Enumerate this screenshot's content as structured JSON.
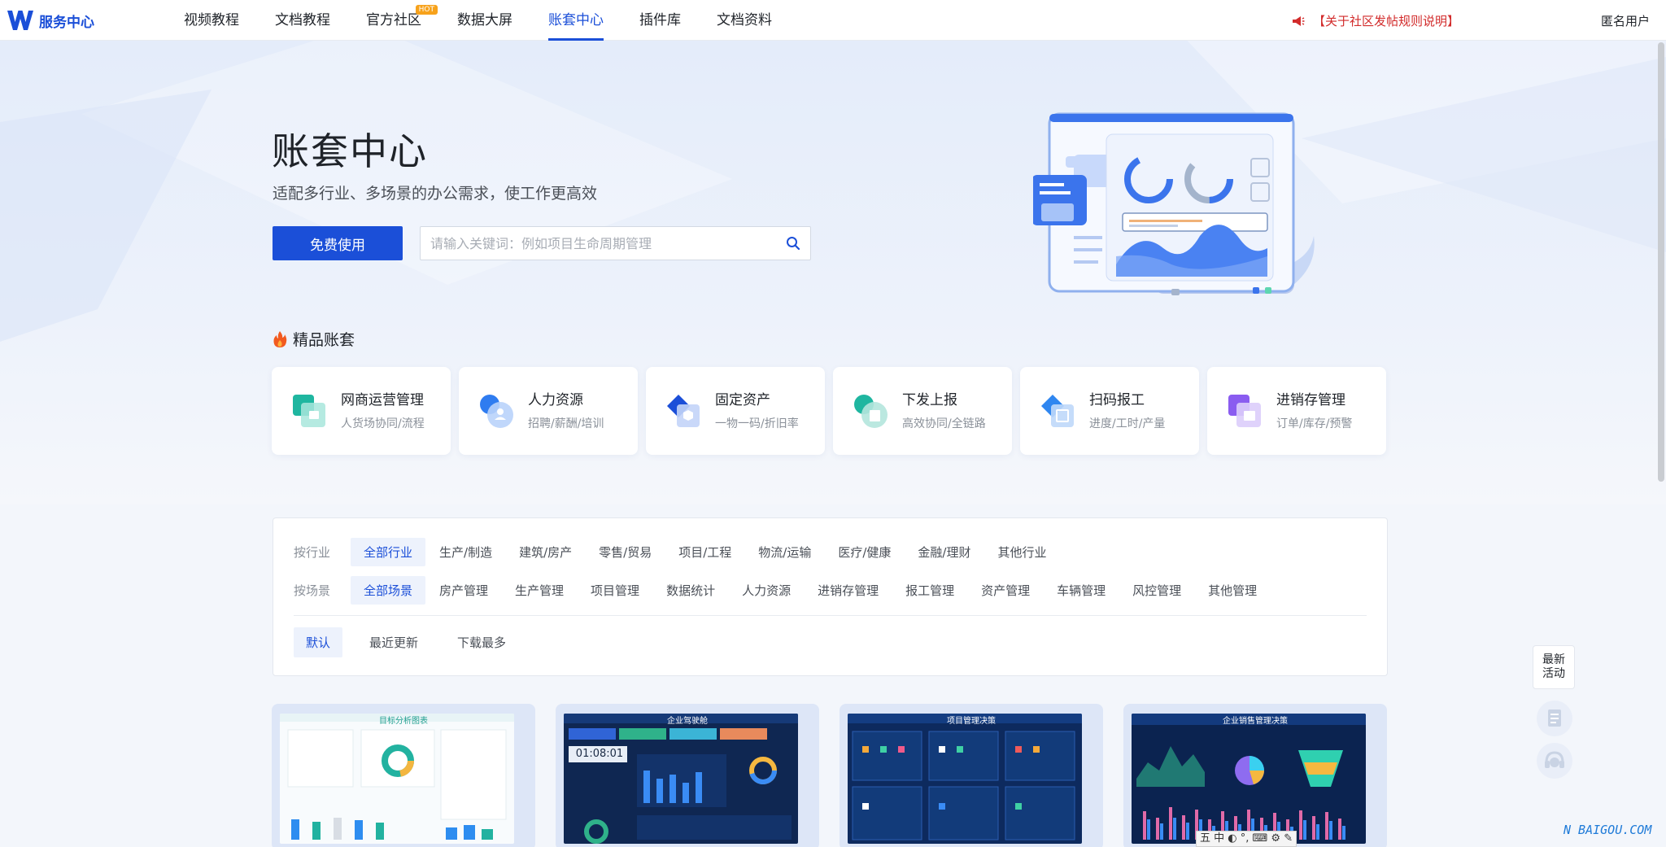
{
  "topbar": {
    "logo_text": "服务中心",
    "nav": [
      {
        "label": "视频教程"
      },
      {
        "label": "文档教程"
      },
      {
        "label": "官方社区",
        "badge": "HOT"
      },
      {
        "label": "数据大屏"
      },
      {
        "label": "账套中心",
        "active": true
      },
      {
        "label": "插件库"
      },
      {
        "label": "文档资料"
      }
    ],
    "notice": "【关于社区发帖规则说明】",
    "user": "匿名用户"
  },
  "hero": {
    "title": "账套中心",
    "subtitle": "适配多行业、多场景的办公需求，使工作更高效",
    "cta_label": "免费使用",
    "search_placeholder": "请输入关键词：例如项目生命周期管理"
  },
  "featured": {
    "title": "精品账套",
    "cards": [
      {
        "title": "网商运营管理",
        "desc": "人货场协同/流程",
        "icon": "shop-icon",
        "color": "#1fb6a0"
      },
      {
        "title": "人力资源",
        "desc": "招聘/薪酬/培训",
        "icon": "people-icon",
        "color": "#2f7cf0"
      },
      {
        "title": "固定资产",
        "desc": "一物一码/折旧率",
        "icon": "box-icon",
        "color": "#1b4fd8"
      },
      {
        "title": "下发上报",
        "desc": "高效协同/全链路",
        "icon": "report-icon",
        "color": "#1fb6a0"
      },
      {
        "title": "扫码报工",
        "desc": "进度/工时/产量",
        "icon": "scan-icon",
        "color": "#2f86f0"
      },
      {
        "title": "进销存管理",
        "desc": "订单/库存/预警",
        "icon": "inventory-icon",
        "color": "#8a5cf0"
      }
    ]
  },
  "filters": {
    "industry_label": "按行业",
    "industries": [
      "全部行业",
      "生产/制造",
      "建筑/房产",
      "零售/贸易",
      "项目/工程",
      "物流/运输",
      "医疗/健康",
      "金融/理财",
      "其他行业"
    ],
    "scene_label": "按场景",
    "scenes": [
      "全部场景",
      "房产管理",
      "生产管理",
      "项目管理",
      "数据统计",
      "人力资源",
      "进销存管理",
      "报工管理",
      "资产管理",
      "车辆管理",
      "风控管理",
      "其他管理"
    ],
    "sorts": [
      "默认",
      "最近更新",
      "下载最多"
    ]
  },
  "templates": [
    {
      "caption": "目标分析图表",
      "theme": "light"
    },
    {
      "caption": "企业驾驶舱",
      "theme": "dark",
      "clock": "01:08:01"
    },
    {
      "caption": "项目管理决策",
      "theme": "dark"
    },
    {
      "caption": "企业销售管理决策",
      "theme": "dark"
    }
  ],
  "floating": {
    "activity_label": "最新\n活动",
    "activity_line1": "最新",
    "activity_line2": "活动"
  },
  "overlay": {
    "watermark": "N BAIGOU.COM",
    "ime": "五 中 ◐ °, ⌨ ⚙ ✎"
  },
  "colors": {
    "primary": "#1b4fd8",
    "notice": "#d22b2b",
    "hot": "#f7a21b"
  }
}
